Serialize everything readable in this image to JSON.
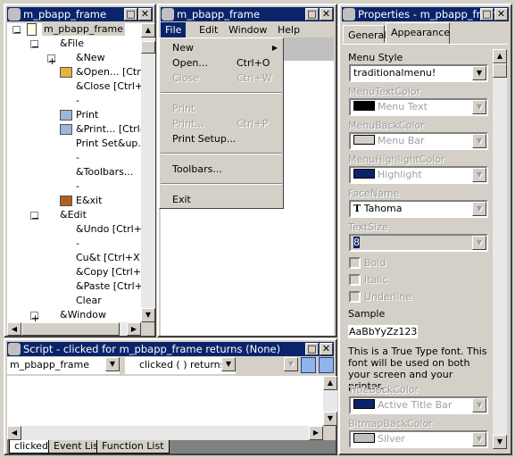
{
  "tree_pane": {
    "title": "m_pbapp_frame",
    "root": "m_pbapp_frame",
    "items": [
      {
        "label": "&File",
        "level": 1,
        "exp": "-"
      },
      {
        "label": "&New",
        "level": 2,
        "exp": "+"
      },
      {
        "label": "&Open...  [Ctrl",
        "level": 2,
        "icon": "folder-open-icon"
      },
      {
        "label": "&Close  [Ctrl+W",
        "level": 2
      },
      {
        "label": "-",
        "level": 2
      },
      {
        "label": "Print",
        "level": 2,
        "icon": "printer-icon"
      },
      {
        "label": "&Print...  [Ctrl-",
        "level": 2,
        "icon": "printer-icon"
      },
      {
        "label": "Print Set&up...",
        "level": 2
      },
      {
        "label": "-",
        "level": 2
      },
      {
        "label": "&Toolbars...",
        "level": 2
      },
      {
        "label": "-",
        "level": 2
      },
      {
        "label": "E&xit",
        "level": 2,
        "icon": "exit-door-icon"
      },
      {
        "label": "&Edit",
        "level": 1,
        "exp": "-"
      },
      {
        "label": "&Undo  [Ctrl+Z",
        "level": 2
      },
      {
        "label": "-",
        "level": 2
      },
      {
        "label": "Cu&t  [Ctrl+X]",
        "level": 2
      },
      {
        "label": "&Copy  [Ctrl+C",
        "level": 2
      },
      {
        "label": "&Paste  [Ctrl+V",
        "level": 2
      },
      {
        "label": "Clear",
        "level": 2
      },
      {
        "label": "&Window",
        "level": 1,
        "exp": "+"
      }
    ]
  },
  "preview_pane": {
    "title": "m_pbapp_frame",
    "menubar": [
      "File",
      "Edit",
      "Window",
      "Help"
    ],
    "menu": [
      {
        "label": "New",
        "shortcut": "",
        "submenu": true,
        "disabled": false
      },
      {
        "label": "Open...",
        "shortcut": "Ctrl+O",
        "disabled": false
      },
      {
        "label": "Close",
        "shortcut": "Ctrl+W",
        "disabled": true
      },
      {
        "sep": true
      },
      {
        "label": "Print",
        "shortcut": "",
        "disabled": true
      },
      {
        "label": "Print...",
        "shortcut": "Ctrl+P",
        "disabled": true
      },
      {
        "label": "Print Setup...",
        "shortcut": "",
        "disabled": false
      },
      {
        "sep": true
      },
      {
        "label": "Toolbars...",
        "shortcut": "",
        "disabled": false
      },
      {
        "sep": true
      },
      {
        "label": "Exit",
        "shortcut": "",
        "disabled": false
      }
    ]
  },
  "properties": {
    "title": "Properties -  m_pbapp_frame",
    "tabs": [
      "General",
      "Appearance"
    ],
    "active_tab": "Appearance",
    "menu_style_label": "Menu Style",
    "menu_style": "traditionalmenu!",
    "menu_text_color_label": "MenuTextColor",
    "menu_text_color": "Menu Text",
    "menu_text_swatch": "#000000",
    "menu_back_color_label": "MenuBackColor",
    "menu_back_color": "Menu Bar",
    "menu_back_swatch": "#d4d0c8",
    "menu_highlight_label": "MenuHighlightColor",
    "menu_highlight": "Highlight",
    "menu_highlight_swatch": "#0a246a",
    "face_name_label": "FaceName",
    "face_name": "Tahoma",
    "text_size_label": "TextSize",
    "text_size": "8",
    "bold": "Bold",
    "italic": "Italic",
    "underline": "Underline",
    "sample_label": "Sample",
    "sample": "AaBbYyZz123",
    "font_note": "This is a True Type font. This font will be used on both your screen and your printer.",
    "title_back_label": "TitleBackColor",
    "title_back": "Active Title Bar",
    "title_back_swatch": "#0a246a",
    "bitmap_back_label": "BitmapBackColor",
    "bitmap_back": "Silver",
    "bitmap_back_swatch": "#c0c0c0"
  },
  "script": {
    "title": "Script - clicked for m_pbapp_frame returns (None)",
    "object": "m_pbapp_frame",
    "event": "clicked ( ) returns (n",
    "tabs": [
      "clicked",
      "Event List",
      "Function List"
    ]
  }
}
